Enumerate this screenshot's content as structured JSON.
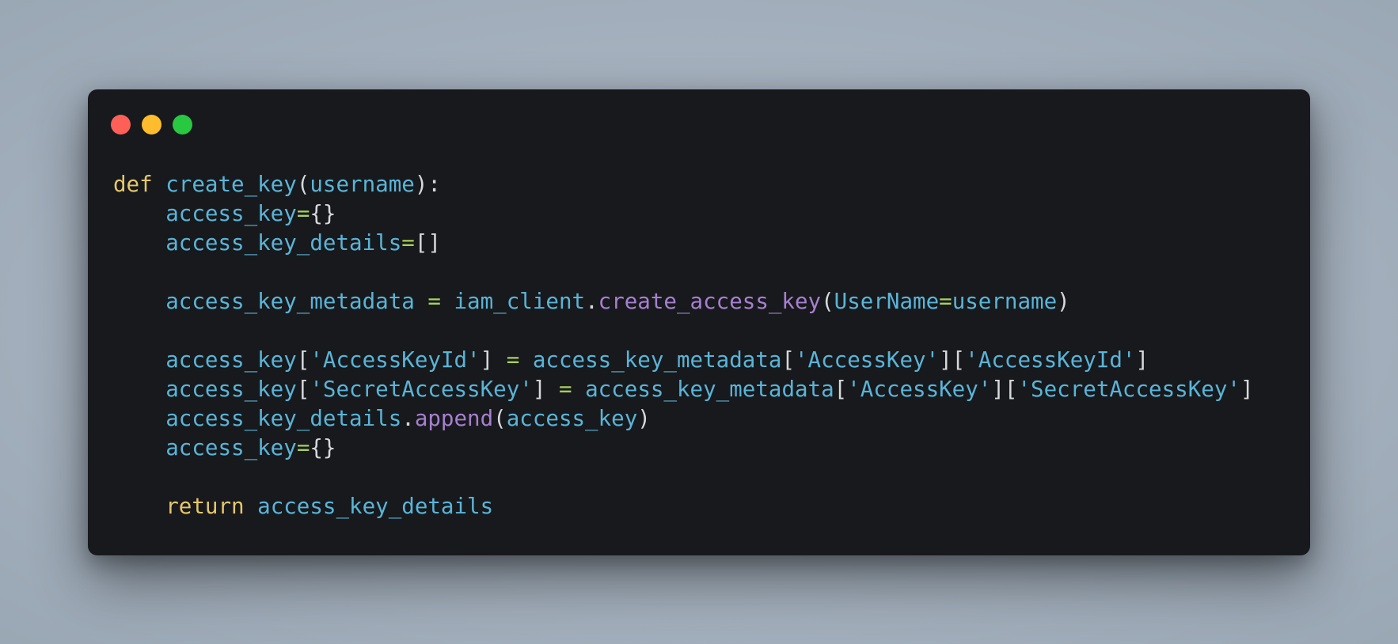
{
  "window": {
    "buttons": {
      "close_color": "#fe5f57",
      "minimize_color": "#febc2e",
      "maximize_color": "#28c840"
    }
  },
  "code": {
    "language": "python",
    "lines": [
      [
        {
          "t": "def",
          "k": "kw"
        },
        {
          "t": " ",
          "k": "p"
        },
        {
          "t": "create_key",
          "k": "id"
        },
        {
          "t": "(",
          "k": "p"
        },
        {
          "t": "username",
          "k": "id"
        },
        {
          "t": "):",
          "k": "p"
        }
      ],
      [
        {
          "t": "    ",
          "k": "p"
        },
        {
          "t": "access_key",
          "k": "id"
        },
        {
          "t": "=",
          "k": "op"
        },
        {
          "t": "{}",
          "k": "p"
        }
      ],
      [
        {
          "t": "    ",
          "k": "p"
        },
        {
          "t": "access_key_details",
          "k": "id"
        },
        {
          "t": "=",
          "k": "op"
        },
        {
          "t": "[]",
          "k": "p"
        }
      ],
      [],
      [
        {
          "t": "    ",
          "k": "p"
        },
        {
          "t": "access_key_metadata",
          "k": "id"
        },
        {
          "t": " ",
          "k": "p"
        },
        {
          "t": "=",
          "k": "op"
        },
        {
          "t": " ",
          "k": "p"
        },
        {
          "t": "iam_client",
          "k": "id"
        },
        {
          "t": ".",
          "k": "p"
        },
        {
          "t": "create_access_key",
          "k": "fn"
        },
        {
          "t": "(",
          "k": "p"
        },
        {
          "t": "UserName",
          "k": "id"
        },
        {
          "t": "=",
          "k": "op"
        },
        {
          "t": "username",
          "k": "id"
        },
        {
          "t": ")",
          "k": "p"
        }
      ],
      [],
      [
        {
          "t": "    ",
          "k": "p"
        },
        {
          "t": "access_key",
          "k": "id"
        },
        {
          "t": "[",
          "k": "p"
        },
        {
          "t": "'AccessKeyId'",
          "k": "str"
        },
        {
          "t": "]",
          "k": "p"
        },
        {
          "t": " ",
          "k": "p"
        },
        {
          "t": "=",
          "k": "op"
        },
        {
          "t": " ",
          "k": "p"
        },
        {
          "t": "access_key_metadata",
          "k": "id"
        },
        {
          "t": "[",
          "k": "p"
        },
        {
          "t": "'AccessKey'",
          "k": "str"
        },
        {
          "t": "][",
          "k": "p"
        },
        {
          "t": "'AccessKeyId'",
          "k": "str"
        },
        {
          "t": "]",
          "k": "p"
        }
      ],
      [
        {
          "t": "    ",
          "k": "p"
        },
        {
          "t": "access_key",
          "k": "id"
        },
        {
          "t": "[",
          "k": "p"
        },
        {
          "t": "'SecretAccessKey'",
          "k": "str"
        },
        {
          "t": "]",
          "k": "p"
        },
        {
          "t": " ",
          "k": "p"
        },
        {
          "t": "=",
          "k": "op"
        },
        {
          "t": " ",
          "k": "p"
        },
        {
          "t": "access_key_metadata",
          "k": "id"
        },
        {
          "t": "[",
          "k": "p"
        },
        {
          "t": "'AccessKey'",
          "k": "str"
        },
        {
          "t": "][",
          "k": "p"
        },
        {
          "t": "'SecretAccessKey'",
          "k": "str"
        },
        {
          "t": "]",
          "k": "p"
        }
      ],
      [
        {
          "t": "    ",
          "k": "p"
        },
        {
          "t": "access_key_details",
          "k": "id"
        },
        {
          "t": ".",
          "k": "p"
        },
        {
          "t": "append",
          "k": "fn"
        },
        {
          "t": "(",
          "k": "p"
        },
        {
          "t": "access_key",
          "k": "id"
        },
        {
          "t": ")",
          "k": "p"
        }
      ],
      [
        {
          "t": "    ",
          "k": "p"
        },
        {
          "t": "access_key",
          "k": "id"
        },
        {
          "t": "=",
          "k": "op"
        },
        {
          "t": "{}",
          "k": "p"
        }
      ],
      [],
      [
        {
          "t": "    ",
          "k": "p"
        },
        {
          "t": "return",
          "k": "kw"
        },
        {
          "t": " ",
          "k": "p"
        },
        {
          "t": "access_key_details",
          "k": "id"
        }
      ]
    ]
  }
}
